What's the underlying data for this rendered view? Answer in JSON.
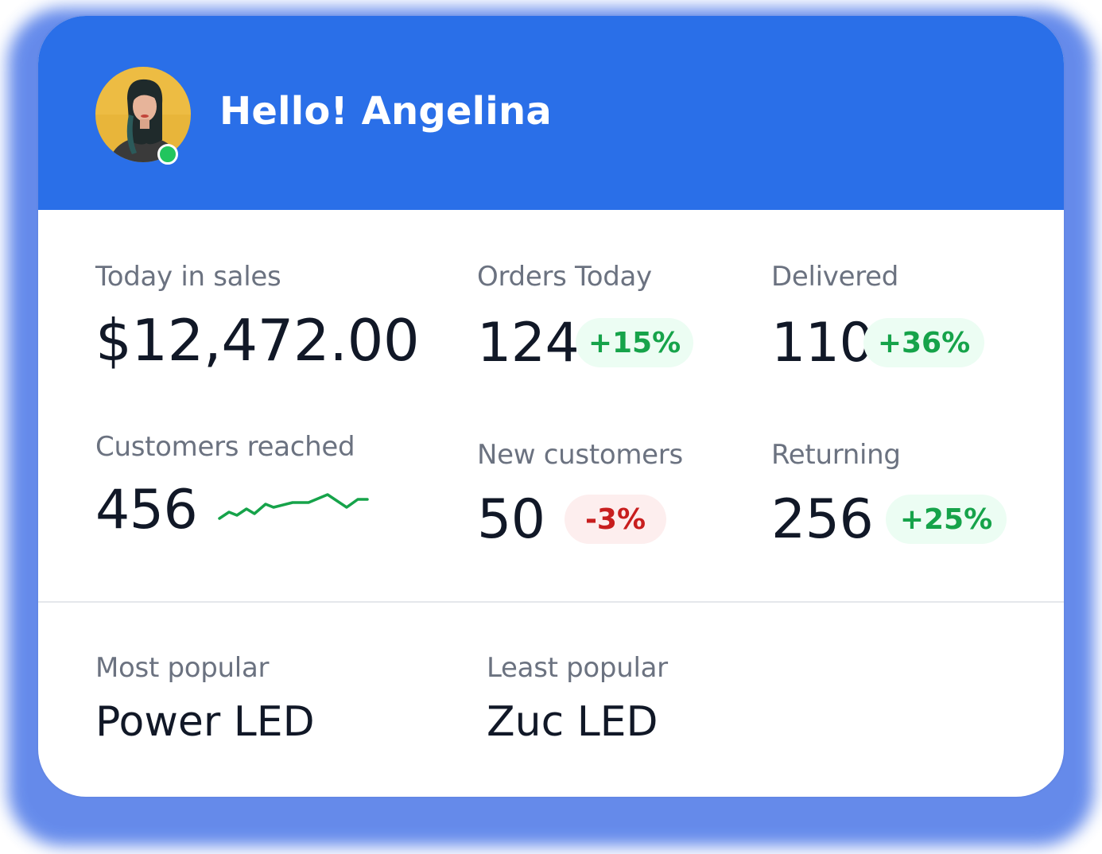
{
  "header": {
    "greeting": "Hello! Angelina",
    "avatar_alt": "avatar",
    "status": "online"
  },
  "stats": {
    "sales": {
      "label": "Today in sales",
      "value": "$12,472.00"
    },
    "orders": {
      "label": "Orders Today",
      "value": "124",
      "change": "+15%"
    },
    "delivered": {
      "label": "Delivered",
      "value": "110",
      "change": "+36%"
    },
    "customers": {
      "label": "Customers reached",
      "value": "456"
    },
    "new_customers": {
      "label": "New customers",
      "value": "50",
      "change": "-3%"
    },
    "returning": {
      "label": "Returning",
      "value": "256",
      "change": "+25%"
    }
  },
  "popularity": {
    "most": {
      "label": "Most popular",
      "value": "Power LED"
    },
    "least": {
      "label": "Least popular",
      "value": "Zuc LED"
    }
  },
  "colors": {
    "header_bg": "#2a6fe8",
    "positive": "#16a34a",
    "negative": "#c81e1e",
    "status_online": "#22c55e"
  }
}
